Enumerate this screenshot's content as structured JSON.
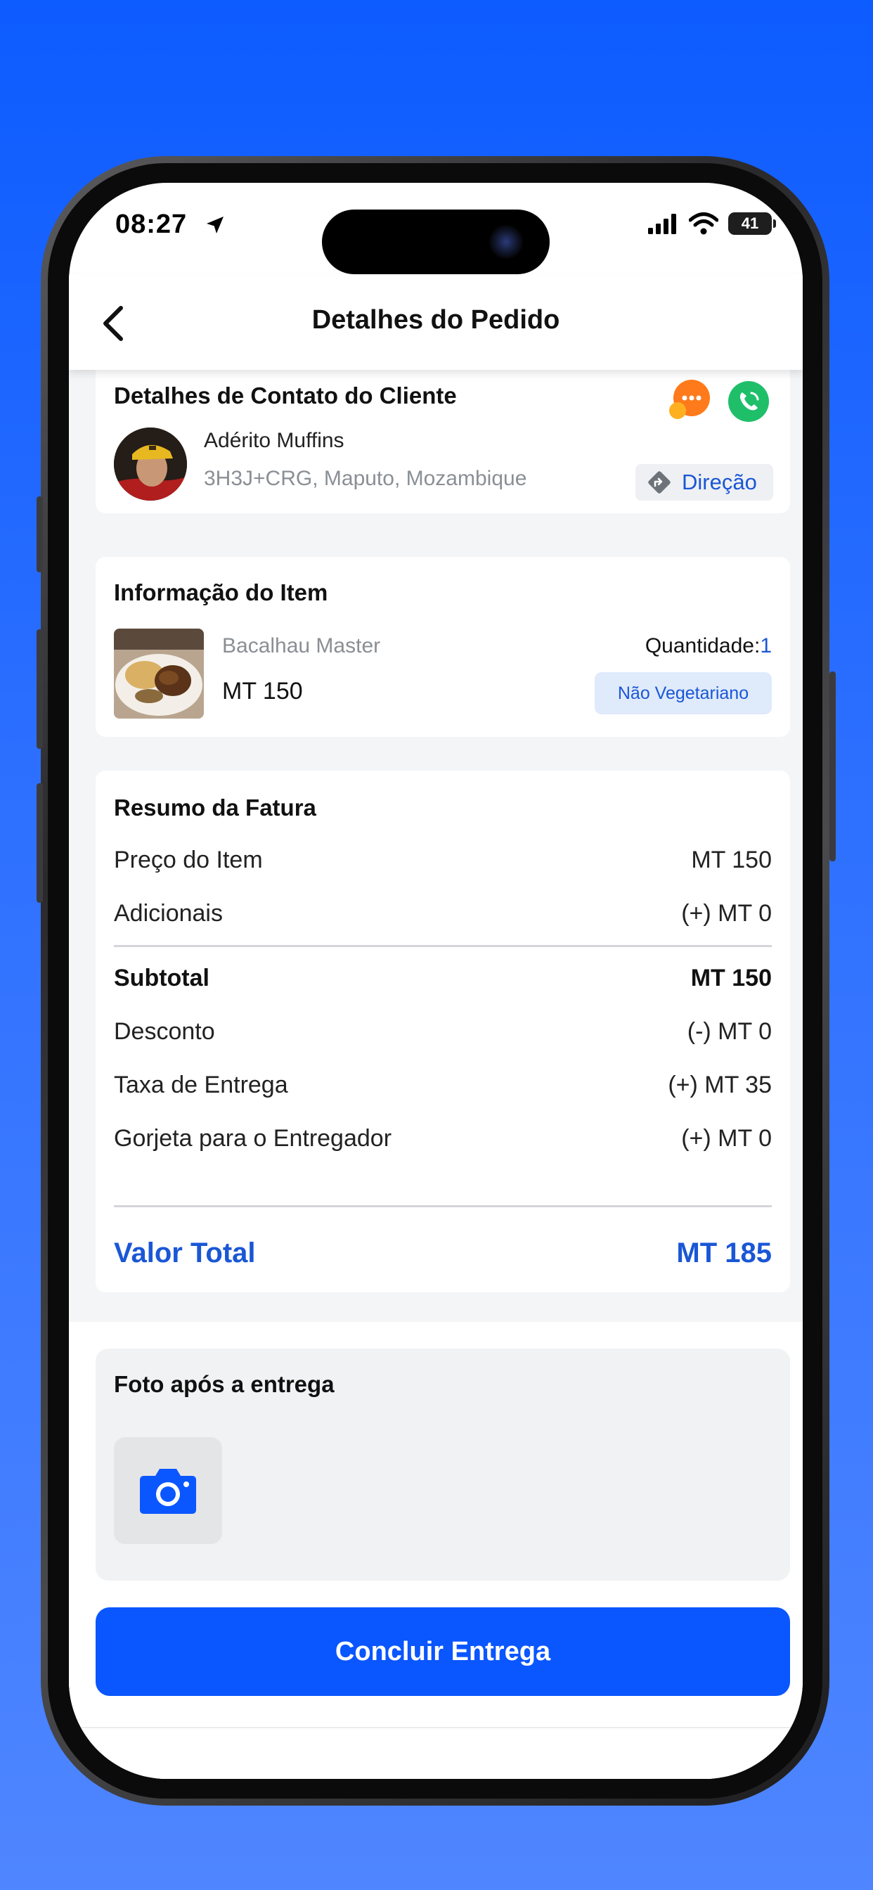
{
  "status_bar": {
    "time": "08:27",
    "battery": "41"
  },
  "header": {
    "title": "Detalhes do Pedido"
  },
  "contact": {
    "title": "Detalhes de Contato do Cliente",
    "name": "Adérito Muffins",
    "address": "3H3J+CRG, Maputo, Mozambique",
    "direction_label": "Direção"
  },
  "item": {
    "title": "Informação do Item",
    "name": "Bacalhau Master",
    "price": "MT 150",
    "quantity_label": "Quantidade:",
    "quantity_value": "1",
    "tag": "Não Vegetariano"
  },
  "invoice": {
    "title": "Resumo da Fatura",
    "item_price_label": "Preço do Item",
    "item_price_value": "MT 150",
    "addons_label": "Adicionais",
    "addons_value": "(+) MT 0",
    "subtotal_label": "Subtotal",
    "subtotal_value": "MT 150",
    "discount_label": "Desconto",
    "discount_value": "(-) MT 0",
    "delivery_fee_label": "Taxa de Entrega",
    "delivery_fee_value": "(+) MT 35",
    "tip_label": "Gorjeta para o Entregador",
    "tip_value": "(+) MT 0",
    "total_label": "Valor Total",
    "total_value": "MT 185"
  },
  "photo": {
    "title": "Foto após a entrega"
  },
  "actions": {
    "complete_label": "Concluir Entrega"
  },
  "colors": {
    "accent": "#0a56ff",
    "chat": "#ff7a1a",
    "call": "#1fbf6a",
    "text_muted": "#8a8f95"
  },
  "icons": [
    "back-arrow-icon",
    "location-arrow-icon",
    "signal-icon",
    "wifi-icon",
    "battery-icon",
    "chat-icon",
    "phone-icon",
    "direction-icon",
    "camera-icon"
  ]
}
